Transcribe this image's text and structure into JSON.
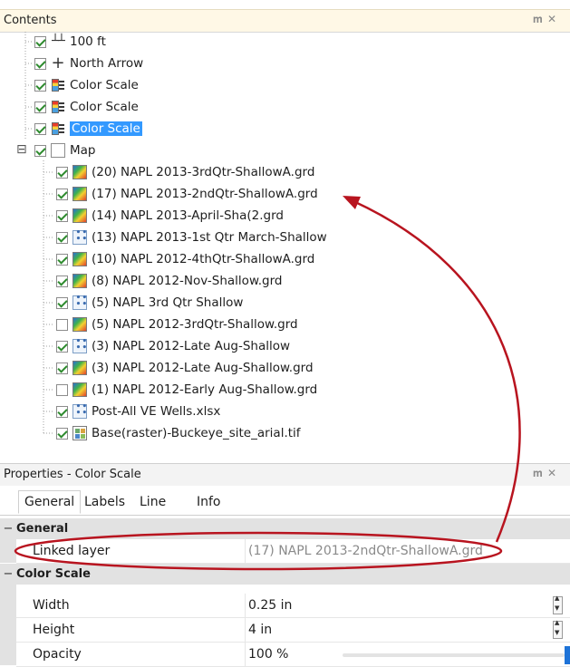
{
  "contents_panel": {
    "title": "Contents",
    "pin_icon": "pin-icon",
    "close_icon": "close-icon"
  },
  "tree": {
    "top_items": [
      {
        "label": "100 ft",
        "icon": "ruler-icon",
        "checked": true
      },
      {
        "label": "North Arrow",
        "icon": "north-arrow-icon",
        "checked": true
      },
      {
        "label": "Color Scale",
        "icon": "color-scale-icon",
        "checked": true
      },
      {
        "label": "Color Scale",
        "icon": "color-scale-icon",
        "checked": true
      },
      {
        "label": "Color Scale",
        "icon": "color-scale-icon",
        "checked": true,
        "selected": true
      }
    ],
    "map": {
      "label": "Map",
      "expand_symbol": "⊟",
      "checked": true
    },
    "map_children": [
      {
        "label": "(20) NAPL 2013-3rdQtr-ShallowA.grd",
        "icon": "grid-icon",
        "checked": true
      },
      {
        "label": "(17) NAPL 2013-2ndQtr-ShallowA.grd",
        "icon": "grid-icon",
        "checked": true
      },
      {
        "label": "(14) NAPL 2013-April-Sha(2.grd",
        "icon": "grid-icon",
        "checked": true
      },
      {
        "label": "(13) NAPL 2013-1st Qtr March-Shallow",
        "icon": "points-icon",
        "checked": true
      },
      {
        "label": "(10) NAPL 2012-4thQtr-ShallowA.grd",
        "icon": "grid-icon",
        "checked": true
      },
      {
        "label": "(8) NAPL 2012-Nov-Shallow.grd",
        "icon": "grid-icon",
        "checked": true
      },
      {
        "label": "(5) NAPL 3rd Qtr Shallow",
        "icon": "points-icon",
        "checked": true
      },
      {
        "label": "(5) NAPL 2012-3rdQtr-Shallow.grd",
        "icon": "grid-icon",
        "checked": false
      },
      {
        "label": "(3) NAPL 2012-Late Aug-Shallow",
        "icon": "points-icon",
        "checked": true
      },
      {
        "label": "(3) NAPL 2012-Late Aug-Shallow.grd",
        "icon": "grid-icon",
        "checked": true
      },
      {
        "label": "(1) NAPL 2012-Early Aug-Shallow.grd",
        "icon": "grid-icon",
        "checked": false
      },
      {
        "label": "Post-All VE Wells.xlsx",
        "icon": "points-icon",
        "checked": true
      },
      {
        "label": "Base(raster)-Buckeye_site_arial.tif",
        "icon": "raster-icon",
        "checked": true
      }
    ]
  },
  "properties_panel": {
    "title": "Properties - Color Scale",
    "tabs": [
      "General",
      "Labels",
      "Line",
      "Info"
    ],
    "active_tab": "General"
  },
  "grid": {
    "general_category": "General",
    "linked_layer_name": "Linked layer",
    "linked_layer_value": "(17) NAPL 2013-2ndQtr-ShallowA.grd",
    "color_scale_category": "Color Scale",
    "props": [
      {
        "name": "Width",
        "value": "0.25 in",
        "control": "spinner"
      },
      {
        "name": "Height",
        "value": "4 in",
        "control": "spinner"
      },
      {
        "name": "Opacity",
        "value": "100 %",
        "control": "slider",
        "level_percent": 100
      }
    ]
  },
  "colors": {
    "selection": "#3399ff",
    "annotation": "#b8141f",
    "check": "#2e8b2e"
  }
}
